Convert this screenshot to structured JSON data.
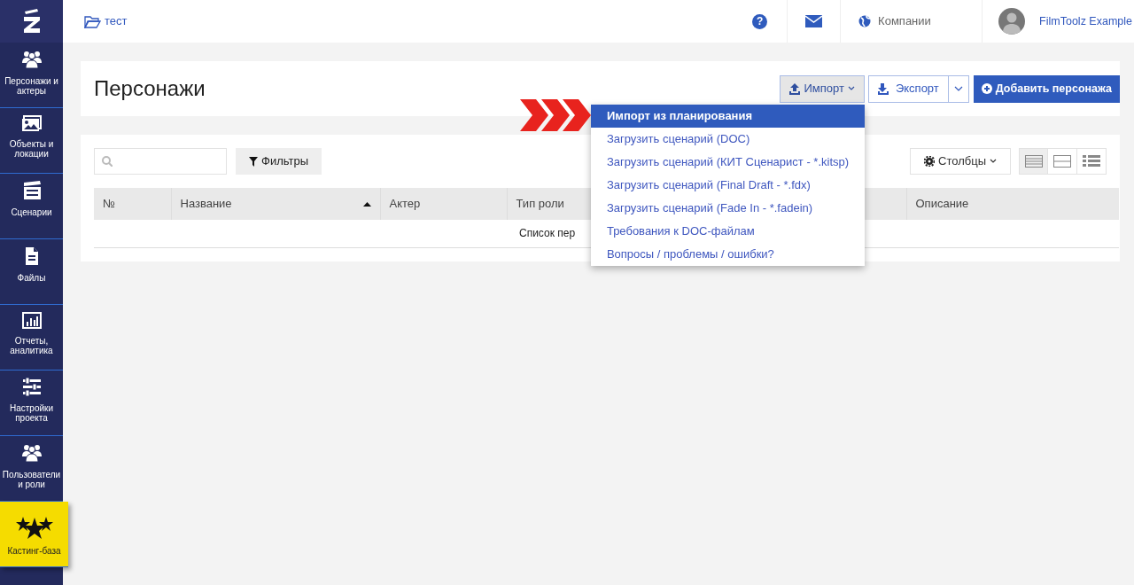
{
  "sidebar": {
    "items": [
      {
        "label": "Персонажи и актеры",
        "kind": "nav"
      },
      {
        "label": "Объекты и локации",
        "kind": "nav"
      },
      {
        "label": "Сценарии",
        "kind": "nav"
      },
      {
        "label": "Файлы",
        "kind": "nav"
      },
      {
        "label": "Отчеты, аналитика",
        "kind": "nav"
      },
      {
        "label": "Настройки проекта",
        "kind": "nav"
      },
      {
        "label": "Пользователи и роли",
        "kind": "nav"
      },
      {
        "label": "Кастинг-база",
        "kind": "promo"
      }
    ]
  },
  "topbar": {
    "breadcrumb": "тест",
    "help": "?",
    "companies": "Компании",
    "user_name": "FilmToolz Example"
  },
  "header": {
    "title": "Персонажи",
    "buttons": [
      {
        "label": "Импорт",
        "kind": "dropdown",
        "expanded": true
      },
      {
        "label": "Экспорт",
        "kind": "split"
      },
      {
        "label": "Добавить персонажа",
        "kind": "primary"
      }
    ],
    "import_menu": [
      {
        "label": "Импорт из планирования",
        "selected": true
      },
      {
        "label": "Загрузить сценарий (DOC)",
        "selected": false
      },
      {
        "label": "Загрузить сценарий (КИТ Сценарист - *.kitsp)",
        "selected": false
      },
      {
        "label": "Загрузить сценарий (Final Draft - *.fdx)",
        "selected": false
      },
      {
        "label": "Загрузить сценарий (Fade In - *.fadein)",
        "selected": false
      },
      {
        "label": "Требования к DOC-файлам",
        "selected": false
      },
      {
        "label": "Вопросы / проблемы / ошибки?",
        "selected": false
      }
    ]
  },
  "toolbar": {
    "filters": "Фильтры",
    "columns": "Столбцы",
    "view_modes": [
      {
        "selected": true
      },
      {
        "selected": false
      },
      {
        "selected": false
      }
    ]
  },
  "table": {
    "columns": [
      {
        "label": "№",
        "sorted_ascending": false
      },
      {
        "label": "Название",
        "sorted_ascending": true
      },
      {
        "label": "Актер",
        "sorted_ascending": false
      },
      {
        "label": "Тип роли",
        "sorted_ascending": false
      },
      {
        "label": "Описание",
        "sorted_ascending": false
      }
    ],
    "empty_message": "Список пер"
  }
}
